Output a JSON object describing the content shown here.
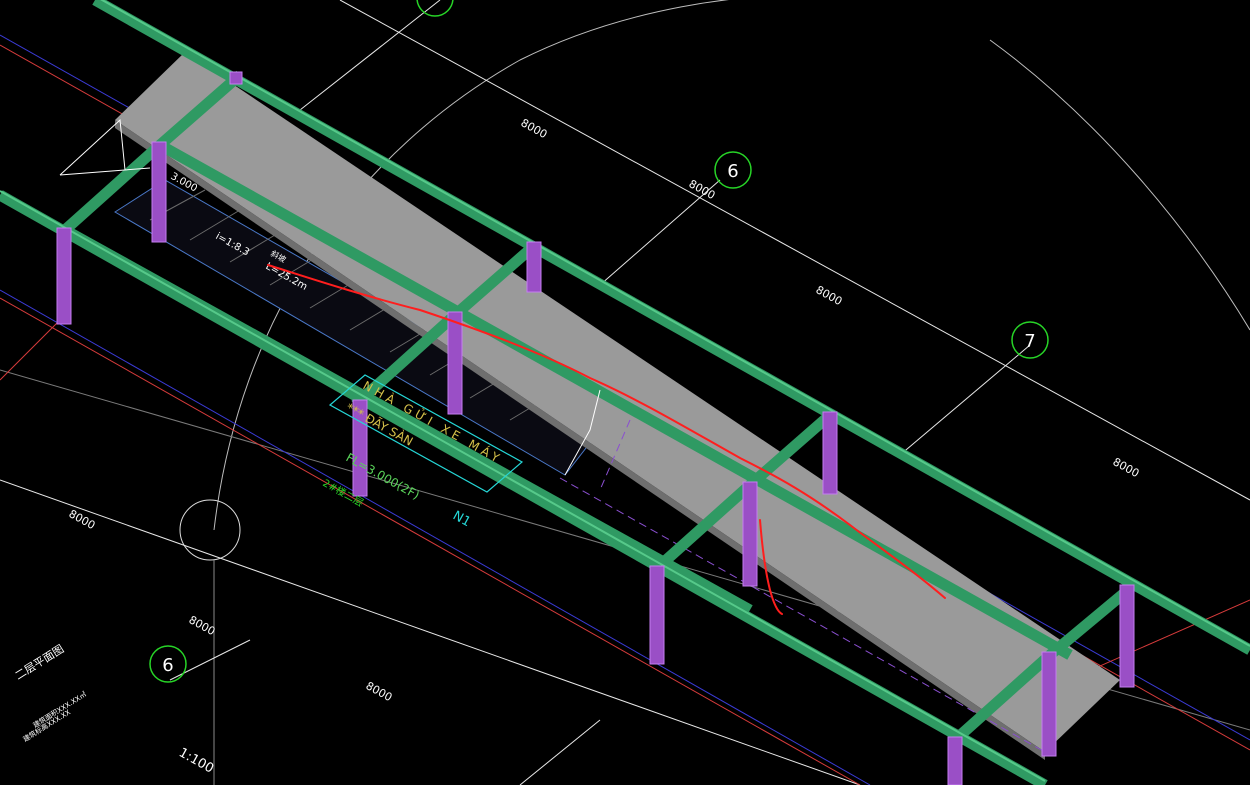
{
  "grid_dimensions": [
    "8000",
    "8000",
    "8000",
    "8000",
    "8000",
    "8000",
    "8000",
    "8000"
  ],
  "grid_bubbles": [
    "6",
    "7",
    "6"
  ],
  "elevation_left": "3.000",
  "slope_text": "i=1:8.3",
  "ramp_label": "斜坡",
  "ramp_length": "L=25.2m",
  "annotation_lines": [
    "NHÀ GỬI XE MÁY",
    "*** ĐÃY SÀN"
  ],
  "floor_level": "FL=3.000(2F)",
  "floor_code": "2#楼二层",
  "label_n1": "N1",
  "plan_title": "二层平面图",
  "scale": "1:100",
  "plan_notes": [
    "建筑面积XXX.XX㎡",
    "建筑标高XXX.XX"
  ],
  "colors": {
    "background": "#000000",
    "beam": "#2f9a63",
    "column": "#9a4fc6",
    "slab": "#9a9a9a",
    "grid_line": "#ffffff",
    "bubble": "#27d427",
    "annotation": "#25d6d6",
    "markup": "#ff1e1e"
  }
}
